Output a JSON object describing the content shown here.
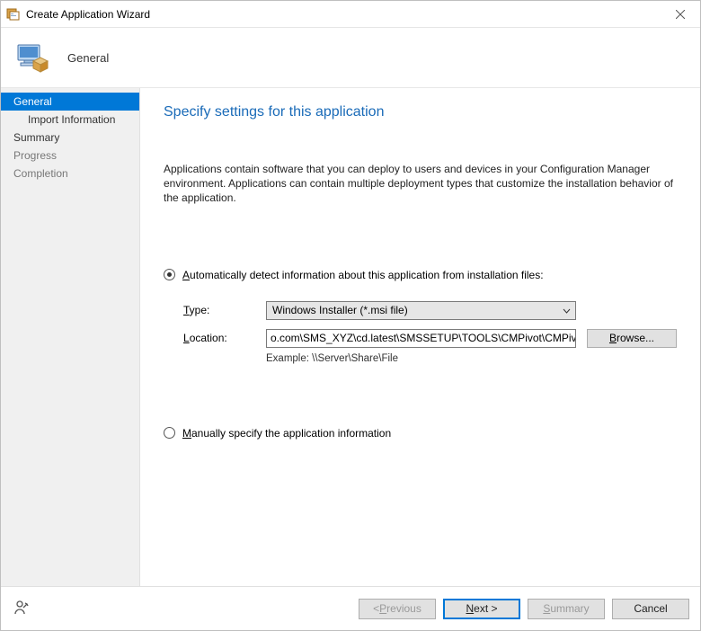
{
  "window": {
    "title": "Create Application Wizard",
    "page_name": "General"
  },
  "sidebar": {
    "items": [
      {
        "label": "General",
        "selected": true,
        "child": false
      },
      {
        "label": "Import Information",
        "selected": false,
        "child": true
      },
      {
        "label": "Summary",
        "selected": false,
        "child": false
      },
      {
        "label": "Progress",
        "selected": false,
        "child": false,
        "dim": true
      },
      {
        "label": "Completion",
        "selected": false,
        "child": false,
        "dim": true
      }
    ]
  },
  "content": {
    "heading": "Specify settings for this application",
    "description": "Applications contain software that you can deploy to users and devices in your Configuration Manager environment. Applications can contain multiple deployment types that customize the installation behavior of the application.",
    "radio_auto": {
      "pre": "A",
      "post": "utomatically detect information about this application from installation files:"
    },
    "radio_manual": {
      "pre": "M",
      "post": "anually specify the application information"
    },
    "type_label_pre": "T",
    "type_label_post": "ype:",
    "type_value": "Windows Installer (*.msi file)",
    "location_label_pre": "L",
    "location_label_post": "ocation:",
    "location_value": "o.com\\SMS_XYZ\\cd.latest\\SMSSETUP\\TOOLS\\CMPivot\\CMPivot.msi",
    "example": "Example: \\\\Server\\Share\\File",
    "browse_pre": "B",
    "browse_post": "rowse..."
  },
  "footer": {
    "previous_pre": "< ",
    "previous_ak": "P",
    "previous_post": "revious",
    "next_ak": "N",
    "next_post": "ext >",
    "summary_ak": "S",
    "summary_post": "ummary",
    "cancel": "Cancel"
  }
}
